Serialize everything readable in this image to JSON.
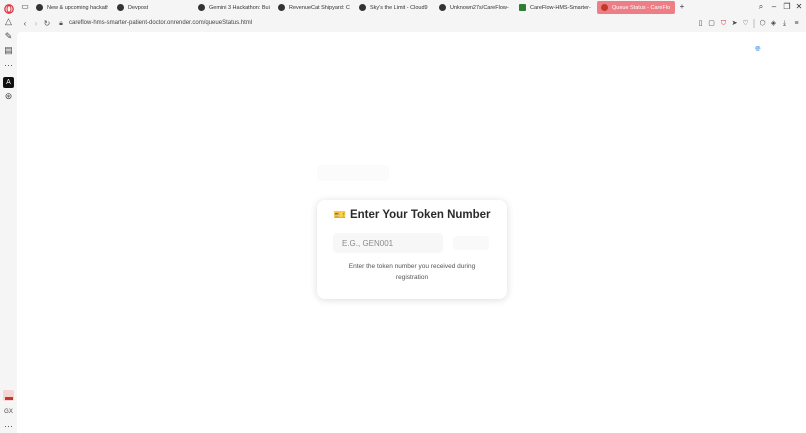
{
  "tabs": [
    {
      "label": "New & upcoming hackath",
      "active": false
    },
    {
      "label": "Devpost",
      "active": false
    },
    {
      "label": "Gemini 3 Hackathon: Bui",
      "active": false
    },
    {
      "label": "RevenueCat Shipyard: Cr",
      "active": false
    },
    {
      "label": "Sky's the Limit - Cloud9",
      "active": false
    },
    {
      "label": "Unknown27s/CareFlow-",
      "active": false
    },
    {
      "label": "CareFlow-HMS-Smarter-",
      "active": false
    },
    {
      "label": "Queue Status - CareFlo",
      "active": true
    }
  ],
  "toolbar": {
    "url": "careflow-hms-smarter-patient-doctor.onrender.com/queueStatus.html"
  },
  "sidebar": {
    "bottom_label": "GX"
  },
  "card": {
    "icon": "ticket-icon",
    "icon_glyph": "🎫",
    "title": "Enter Your Token Number",
    "input_placeholder": "E.G., GEN001",
    "hint": "Enter the token number you received during registration"
  },
  "colors": {
    "active_tab": "#ee7e86",
    "ticket": "#e2a023"
  }
}
